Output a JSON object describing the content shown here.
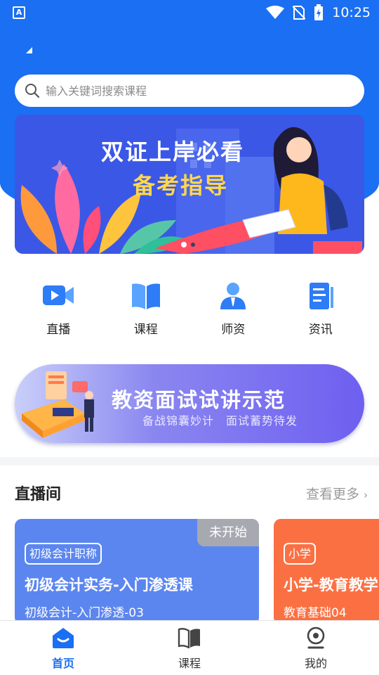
{
  "status_bar": {
    "time": "10:25",
    "app_icon_letter": "A"
  },
  "search": {
    "placeholder": "输入关键词搜索课程"
  },
  "banner": {
    "line1": "双证上岸必看",
    "line2": "备考指导",
    "active_dot": 0,
    "dot_count": 2
  },
  "quick_nav": [
    {
      "label": "直播",
      "icon": "video-icon"
    },
    {
      "label": "课程",
      "icon": "book-icon"
    },
    {
      "label": "师资",
      "icon": "teacher-icon"
    },
    {
      "label": "资讯",
      "icon": "document-icon"
    }
  ],
  "promo": {
    "title": "教资面试试讲示范",
    "subtitle": "备战锦囊妙计　面试蓄势待发"
  },
  "live_section": {
    "title": "直播间",
    "more": "查看更多",
    "cards": [
      {
        "tag": "初级会计职称",
        "title": "初级会计实务-入门渗透课",
        "subtitle": "初级会计-入门渗透-03",
        "status": "未开始",
        "color": "#5c86ef"
      },
      {
        "tag": "小学",
        "title": "小学-教育教学",
        "subtitle": "教育基础04",
        "color": "#fb7043"
      }
    ]
  },
  "tab_bar": [
    {
      "label": "首页",
      "icon": "home-icon",
      "active": true
    },
    {
      "label": "课程",
      "icon": "book-icon",
      "active": false
    },
    {
      "label": "我的",
      "icon": "profile-icon",
      "active": false
    }
  ],
  "colors": {
    "primary": "#1a6ff2"
  }
}
